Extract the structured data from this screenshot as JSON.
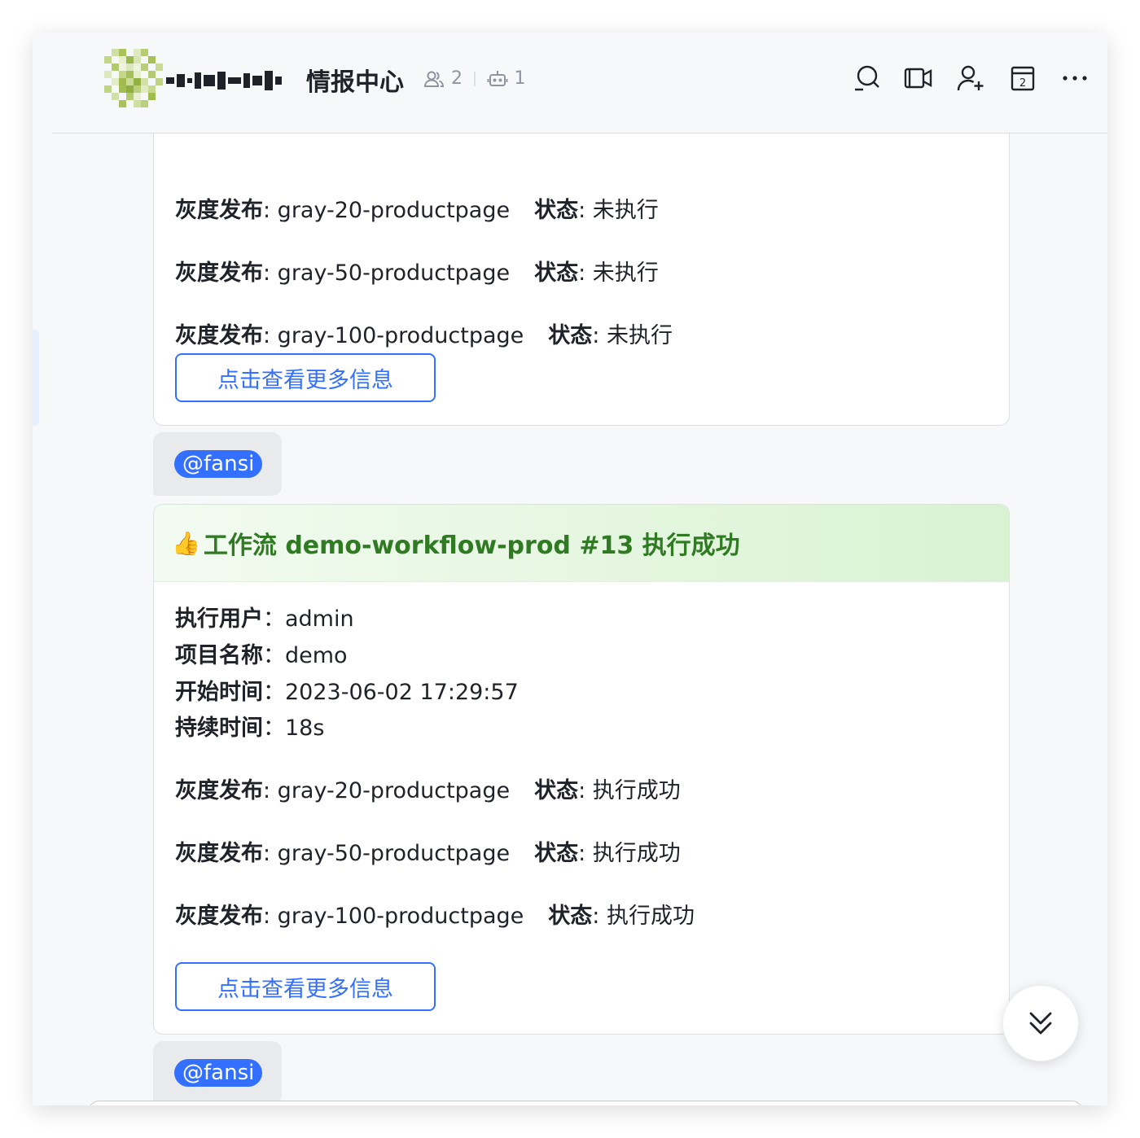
{
  "header": {
    "title": "情报中心",
    "member_count": "2",
    "bot_count": "1",
    "tools": [
      "search-icon",
      "video-call-icon",
      "add-member-icon",
      "calendar-icon",
      "more-icon"
    ],
    "calendar_day": "2"
  },
  "card1": {
    "rows": [
      {
        "label": "灰度发布",
        "value": ": gray-20-productpage",
        "status_label": "状态",
        "status": ": 未执行"
      },
      {
        "label": "灰度发布",
        "value": ": gray-50-productpage",
        "status_label": "状态",
        "status": ": 未执行"
      },
      {
        "label": "灰度发布",
        "value": ": gray-100-productpage",
        "status_label": "状态",
        "status": ": 未执行"
      }
    ],
    "button": "点击查看更多信息"
  },
  "mention1": "@fansi",
  "card2": {
    "emoji": "👍",
    "title": "工作流 demo-workflow-prod #13 执行成功",
    "info": [
      {
        "label": "执行用户",
        "sep": "：",
        "value": "admin"
      },
      {
        "label": "项目名称",
        "sep": "：",
        "value": "demo"
      },
      {
        "label": "开始时间",
        "sep": "：",
        "value": "2023-06-02 17:29:57"
      },
      {
        "label": "持续时间",
        "sep": "：",
        "value": "18s"
      }
    ],
    "rows": [
      {
        "label": "灰度发布",
        "value": ": gray-20-productpage",
        "status_label": "状态",
        "status": ": 执行成功"
      },
      {
        "label": "灰度发布",
        "value": ": gray-50-productpage",
        "status_label": "状态",
        "status": ": 执行成功"
      },
      {
        "label": "灰度发布",
        "value": ": gray-100-productpage",
        "status_label": "状态",
        "status": ": 执行成功"
      }
    ],
    "button": "点击查看更多信息"
  },
  "mention2": "@fansi",
  "colors": {
    "accent": "#3370ff",
    "success_text": "#2f7a23",
    "success_bg": "#e3f6de",
    "bubble_bg": "#e9eaec"
  }
}
